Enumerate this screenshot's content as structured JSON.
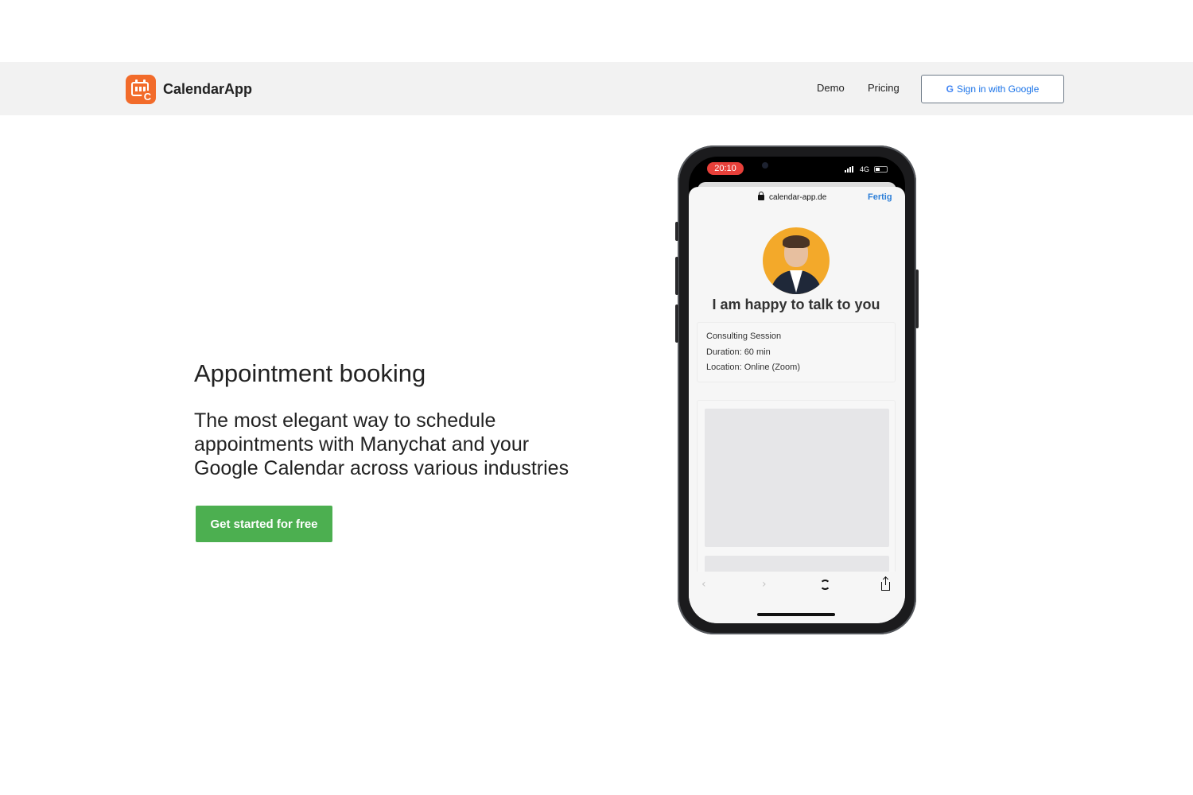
{
  "header": {
    "app_name": "CalendarApp",
    "nav": {
      "demo": "Demo",
      "pricing": "Pricing"
    },
    "signin_label": "Sign in with Google",
    "signin_icon": "G"
  },
  "hero": {
    "title": "Appointment booking",
    "subtitle": "The most elegant way to schedule appointments with Manychat and your Google Calendar across various industries",
    "cta_label": "Get started for free"
  },
  "phone": {
    "status_time": "20:10",
    "network": "4G",
    "url": "calendar-app.de",
    "done_label": "Fertig",
    "headline": "I am happy to talk to you",
    "details": {
      "session": "Consulting Session",
      "duration": "Duration: 60 min",
      "location": "Location: Online (Zoom)"
    },
    "nav_back": "‹",
    "nav_forward": "›"
  },
  "colors": {
    "brand_orange": "#f26b2a",
    "cta_green": "#4caf50",
    "google_blue": "#1a73e8",
    "status_red": "#e8403a"
  },
  "icons": [
    "calendar-logo-icon",
    "google-icon",
    "lock-icon",
    "signal-icon",
    "battery-icon",
    "back-arrow-icon",
    "forward-arrow-icon",
    "reload-icon",
    "share-icon"
  ]
}
